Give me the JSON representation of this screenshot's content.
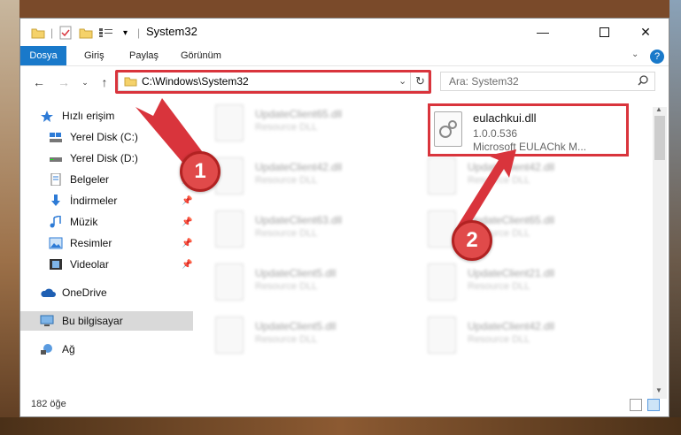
{
  "window": {
    "title": "System32"
  },
  "ribbon": {
    "tabs": [
      "Dosya",
      "Giriş",
      "Paylaş",
      "Görünüm"
    ]
  },
  "address": {
    "path": "C:\\Windows\\System32"
  },
  "search": {
    "placeholder": "Ara: System32"
  },
  "sidebar": {
    "quick_access": "Hızlı erişim",
    "items": [
      "Yerel Disk (C:)",
      "Yerel Disk (D:)",
      "Belgeler",
      "İndirmeler",
      "Müzik",
      "Resimler",
      "Videolar"
    ],
    "onedrive": "OneDrive",
    "this_pc": "Bu bilgisayar",
    "network": "Ağ"
  },
  "files": {
    "left": [
      {
        "name": "UpdateClient65.dll",
        "desc": "Resource DLL"
      },
      {
        "name": "UpdateClient42.dll",
        "desc": "Resource DLL"
      },
      {
        "name": "UpdateClient63.dll",
        "desc": "Resource DLL"
      },
      {
        "name": "UpdateClient5.dll",
        "desc": "Resource DLL"
      },
      {
        "name": "UpdateClient5.dll",
        "desc": "Resource DLL"
      }
    ],
    "right": [
      {
        "name": "UpdateClient42.dll",
        "desc": "Resource DLL"
      },
      {
        "name": "UpdateClient65.dll",
        "desc": "Resource DLL"
      },
      {
        "name": "UpdateClient21.dll",
        "desc": "Resource DLL"
      },
      {
        "name": "UpdateClient42.dll",
        "desc": "Resource DLL"
      }
    ],
    "selected": {
      "name": "eulachkui.dll",
      "version": "1.0.0.536",
      "desc": "Microsoft EULAChk M..."
    }
  },
  "status": {
    "count": "182 öğe"
  },
  "badges": [
    "1",
    "2"
  ],
  "colors": {
    "accent": "#1979ca",
    "highlight": "#d9343c"
  }
}
